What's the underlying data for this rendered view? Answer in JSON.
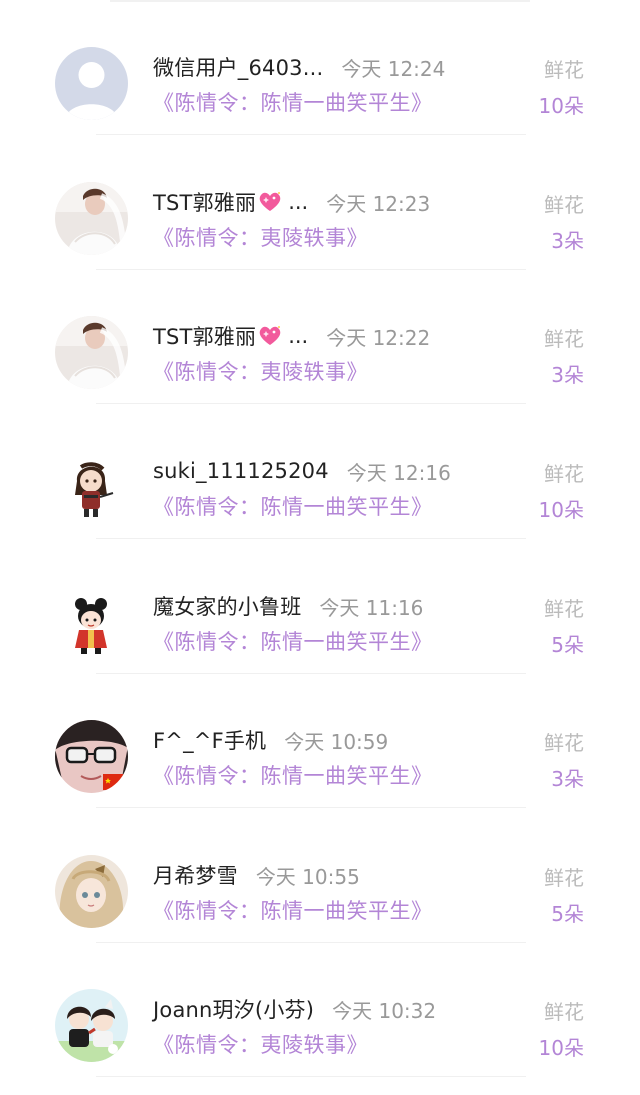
{
  "records": [
    {
      "avatar_icon": "default-user-avatar-icon",
      "username": "微信用户_6403...",
      "emoji": "",
      "time": "今天 12:24",
      "book": "《陈情令：陈情一曲笑平生》",
      "gift_label": "鲜花",
      "gift_count": "10朵"
    },
    {
      "avatar_icon": "bride-photo-avatar-icon",
      "username": "TST郭雅丽",
      "emoji": "sparkling-heart-icon",
      "ellipsis": "...",
      "time": "今天 12:23",
      "book": "《陈情令：夷陵轶事》",
      "gift_label": "鲜花",
      "gift_count": "3朵"
    },
    {
      "avatar_icon": "bride-photo-avatar-icon",
      "username": "TST郭雅丽",
      "emoji": "sparkling-heart-icon",
      "ellipsis": "...",
      "time": "今天 12:22",
      "book": "《陈情令：夷陵轶事》",
      "gift_label": "鲜花",
      "gift_count": "3朵"
    },
    {
      "avatar_icon": "chibi-character-avatar-icon",
      "username": "suki_111125204",
      "emoji": "",
      "time": "今天 12:16",
      "book": "《陈情令：陈情一曲笑平生》",
      "gift_label": "鲜花",
      "gift_count": "10朵"
    },
    {
      "avatar_icon": "chibi-girl-red-avatar-icon",
      "username": "魔女家的小鲁班",
      "emoji": "",
      "time": "今天 11:16",
      "book": "《陈情令：陈情一曲笑平生》",
      "gift_label": "鲜花",
      "gift_count": "5朵"
    },
    {
      "avatar_icon": "girl-glasses-avatar-icon",
      "username": "F^_^F手机",
      "emoji": "",
      "time": "今天 10:59",
      "book": "《陈情令：陈情一曲笑平生》",
      "gift_label": "鲜花",
      "gift_count": "3朵"
    },
    {
      "avatar_icon": "anime-girl-avatar-icon",
      "username": "月希梦雪",
      "emoji": "",
      "time": "今天 10:55",
      "book": "《陈情令：陈情一曲笑平生》",
      "gift_label": "鲜花",
      "gift_count": "5朵"
    },
    {
      "avatar_icon": "anime-duo-avatar-icon",
      "username": "Joann玥汐(小芬)",
      "emoji": "",
      "time": "今天 10:32",
      "book": "《陈情令：夷陵轶事》",
      "gift_label": "鲜花",
      "gift_count": "10朵"
    }
  ],
  "colors": {
    "accent_purple": "#b385d6",
    "name_text": "#222222",
    "time_text": "#999999",
    "label_gray": "#bbbbbb",
    "divider": "#f0f0f0"
  }
}
